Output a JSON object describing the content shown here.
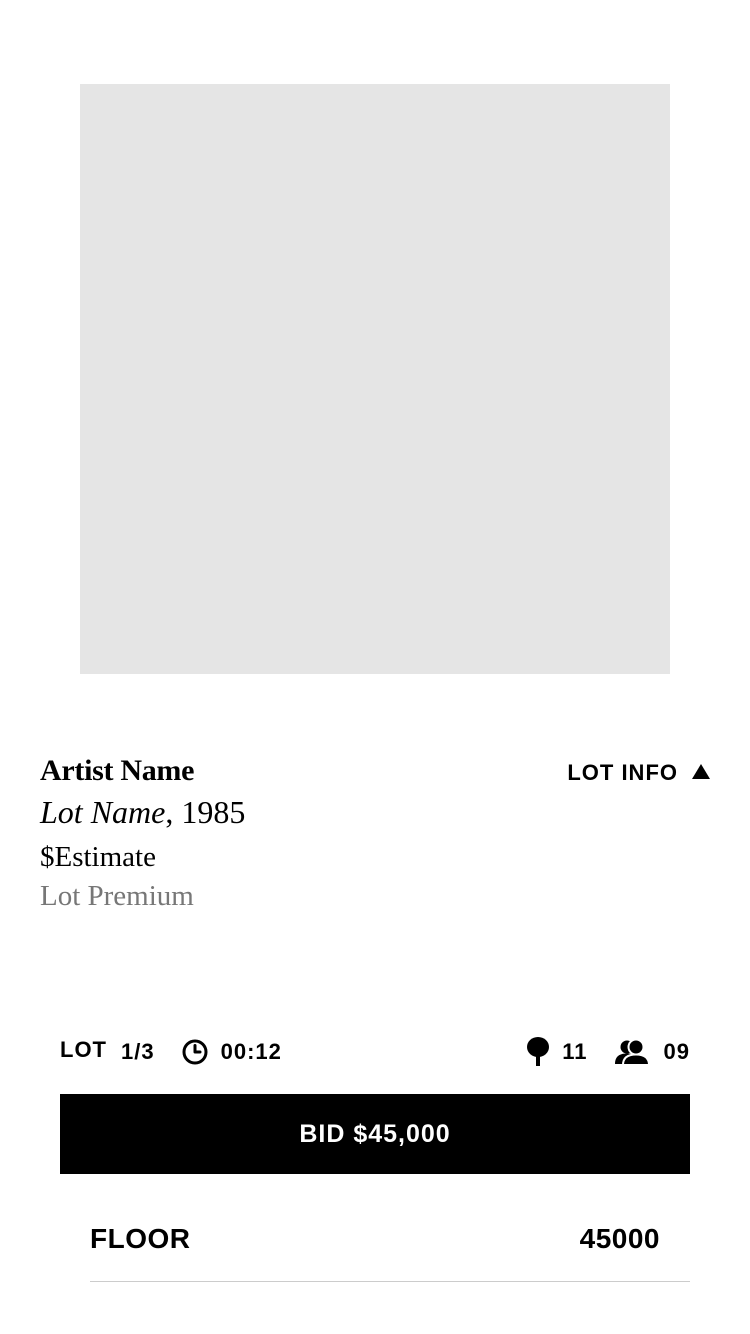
{
  "lot": {
    "artist_name": "Artist Name",
    "lot_name": "Lot Name",
    "year_separator": ", ",
    "year": "1985",
    "estimate": "$Estimate",
    "premium": "Lot Premium",
    "info_toggle_label": "LOT INFO"
  },
  "status": {
    "lot_label": "LOT",
    "lot_counter": "1/3",
    "timer": "00:12",
    "paddle_count": "11",
    "bidders_count": "09"
  },
  "bid": {
    "button_label": "BID $45,000"
  },
  "floor": {
    "label": "FLOOR",
    "value": "45000"
  },
  "colors": {
    "image_placeholder": "#e5e5e5",
    "primary": "#000000",
    "muted_text": "#777777",
    "divider": "#cccccc"
  },
  "icons": {
    "clock": "clock-icon",
    "paddle": "paddle-icon",
    "bidders": "bidders-icon",
    "toggle": "triangle-up-icon"
  }
}
